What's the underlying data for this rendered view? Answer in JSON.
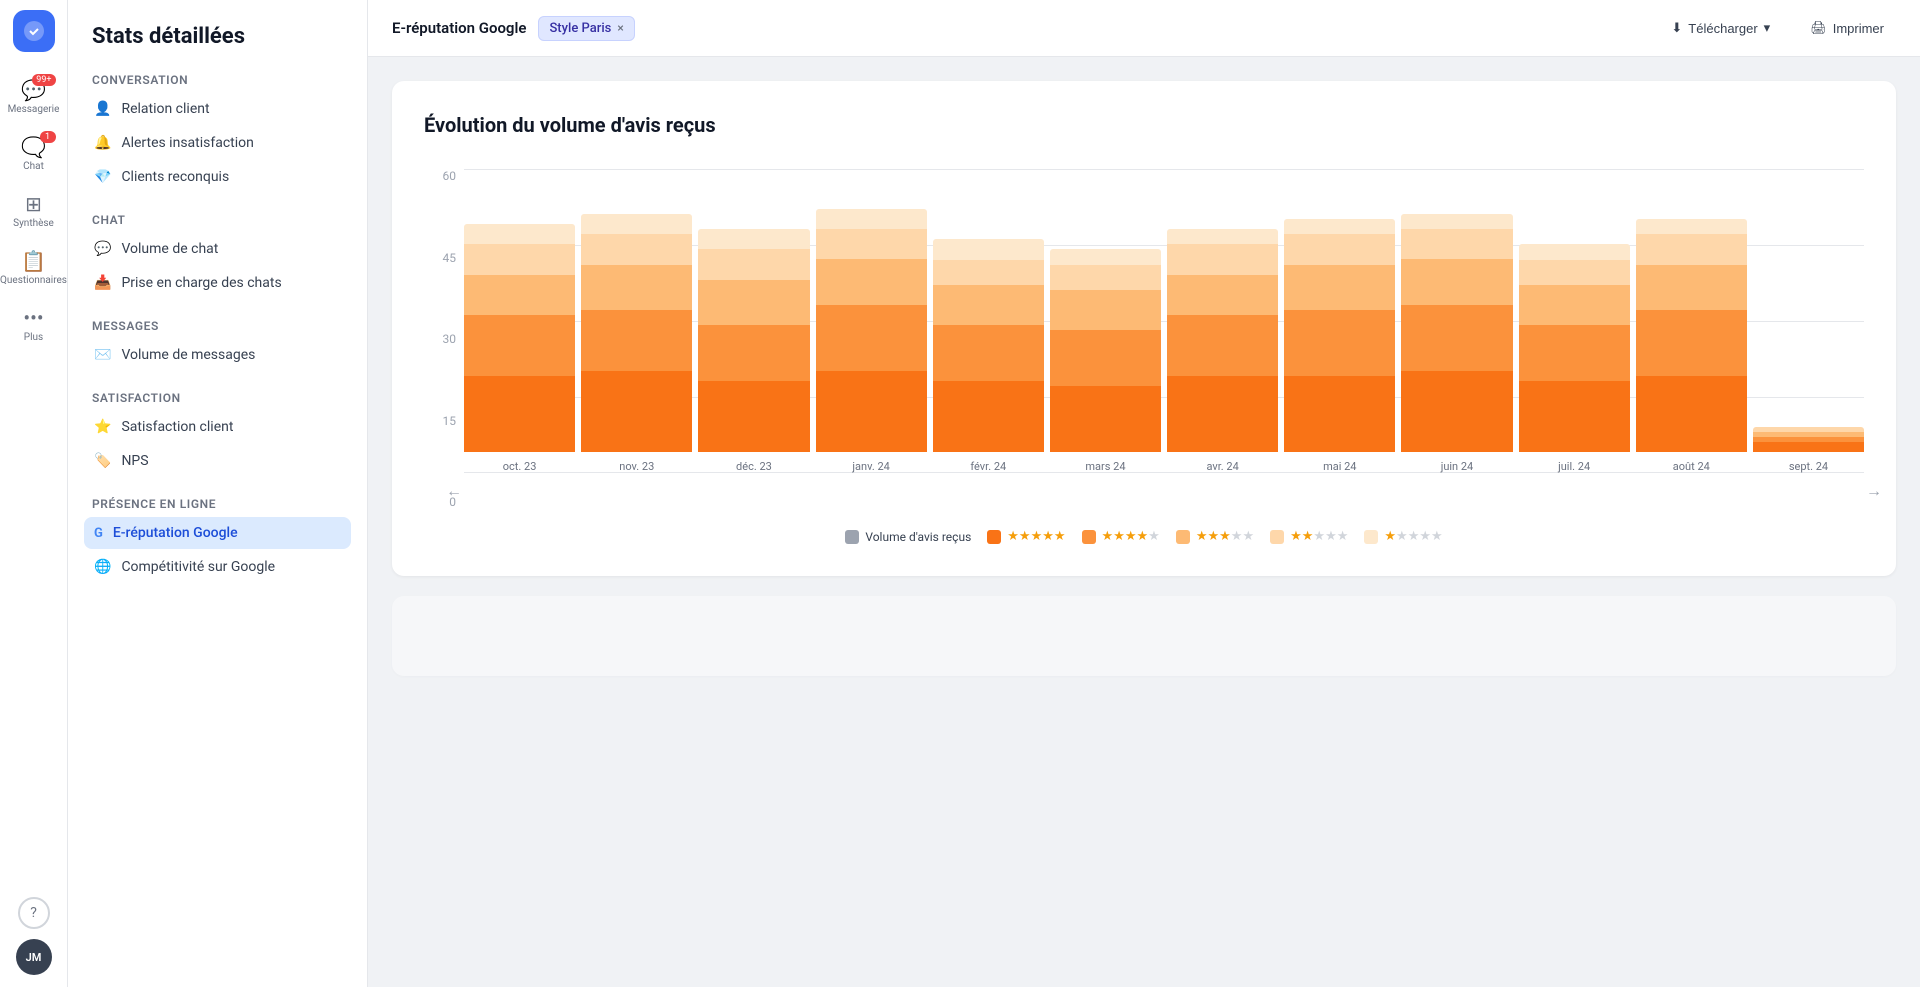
{
  "app": {
    "logo_alt": "App logo"
  },
  "iconBar": {
    "items": [
      {
        "id": "messagerie",
        "label": "Messagerie",
        "icon": "💬",
        "badge": "99+"
      },
      {
        "id": "chat",
        "label": "Chat",
        "icon": "🗨️",
        "badge": "1"
      },
      {
        "id": "synthese",
        "label": "Synthèse",
        "icon": "⊞",
        "badge": null
      },
      {
        "id": "questionnaires",
        "label": "Questionnaires",
        "icon": "📋",
        "badge": null
      },
      {
        "id": "plus",
        "label": "Plus",
        "icon": "⋯",
        "badge": null
      }
    ],
    "help_label": "?",
    "avatar_label": "JM"
  },
  "sidebar": {
    "title": "Stats détaillées",
    "sections": [
      {
        "id": "conversation",
        "label": "Conversation",
        "items": [
          {
            "id": "relation-client",
            "label": "Relation client",
            "icon": "👤"
          },
          {
            "id": "alertes-insatisfaction",
            "label": "Alertes insatisfaction",
            "icon": "🔔"
          },
          {
            "id": "clients-reconquis",
            "label": "Clients reconquis",
            "icon": "💎"
          }
        ]
      },
      {
        "id": "chat",
        "label": "Chat",
        "items": [
          {
            "id": "volume-chat",
            "label": "Volume de chat",
            "icon": "💬"
          },
          {
            "id": "prise-en-charge",
            "label": "Prise en charge des chats",
            "icon": "📥"
          }
        ]
      },
      {
        "id": "messages",
        "label": "Messages",
        "items": [
          {
            "id": "volume-messages",
            "label": "Volume de messages",
            "icon": "✉️"
          }
        ]
      },
      {
        "id": "satisfaction",
        "label": "Satisfaction",
        "items": [
          {
            "id": "satisfaction-client",
            "label": "Satisfaction client",
            "icon": "⭐"
          },
          {
            "id": "nps",
            "label": "NPS",
            "icon": "🏷️"
          }
        ]
      },
      {
        "id": "presence-en-ligne",
        "label": "Présence en ligne",
        "items": [
          {
            "id": "e-reputation-google",
            "label": "E-réputation Google",
            "icon": "G",
            "active": true
          },
          {
            "id": "competitivite-google",
            "label": "Compétitivité sur Google",
            "icon": "🌐"
          }
        ]
      }
    ]
  },
  "topBar": {
    "title": "E-réputation Google",
    "filter": {
      "label": "Style Paris",
      "close": "×"
    },
    "actions": [
      {
        "id": "telecharger",
        "label": "Télécharger",
        "icon": "⬇"
      },
      {
        "id": "imprimer",
        "label": "Imprimer",
        "icon": "🖨"
      }
    ]
  },
  "chart": {
    "title": "Évolution du volume d'avis reçus",
    "yLabels": [
      "60",
      "45",
      "30",
      "15",
      "0"
    ],
    "maxValue": 60,
    "bars": [
      {
        "month": "oct. 23",
        "total": 45,
        "segments": [
          15,
          12,
          8,
          6,
          4
        ]
      },
      {
        "month": "nov. 23",
        "total": 47,
        "segments": [
          16,
          12,
          9,
          6,
          4
        ]
      },
      {
        "month": "déc. 23",
        "total": 44,
        "segments": [
          14,
          11,
          9,
          6,
          4
        ]
      },
      {
        "month": "janv. 24",
        "total": 48,
        "segments": [
          16,
          13,
          9,
          6,
          4
        ]
      },
      {
        "month": "févr. 24",
        "total": 42,
        "segments": [
          14,
          11,
          8,
          5,
          4
        ]
      },
      {
        "month": "mars 24",
        "total": 40,
        "segments": [
          13,
          11,
          8,
          5,
          3
        ]
      },
      {
        "month": "avr. 24",
        "total": 44,
        "segments": [
          15,
          12,
          8,
          6,
          3
        ]
      },
      {
        "month": "mai 24",
        "total": 46,
        "segments": [
          15,
          13,
          9,
          6,
          3
        ]
      },
      {
        "month": "juin 24",
        "total": 47,
        "segments": [
          16,
          13,
          9,
          6,
          3
        ]
      },
      {
        "month": "juil. 24",
        "total": 41,
        "segments": [
          14,
          11,
          8,
          5,
          3
        ]
      },
      {
        "month": "août 24",
        "total": 46,
        "segments": [
          15,
          13,
          9,
          6,
          3
        ]
      },
      {
        "month": "sept. 24",
        "total": 5,
        "segments": [
          2,
          1,
          1,
          1,
          0
        ]
      }
    ],
    "segmentColors": [
      "#f97316",
      "#fb923c",
      "#fdba74",
      "#fed7aa",
      "#fde8cc"
    ],
    "nav": {
      "prev": "←",
      "next": "→"
    },
    "legend": {
      "volumeLabel": "Volume d'avis reçus",
      "volumeColor": "#9ca3af",
      "ratings": [
        {
          "id": "5stars",
          "stars": 5,
          "color": "#f97316",
          "checked": true
        },
        {
          "id": "4stars",
          "stars": 4,
          "color": "#fb923c",
          "checked": true
        },
        {
          "id": "3stars",
          "stars": 3,
          "color": "#fdba74",
          "checked": true
        },
        {
          "id": "2stars",
          "stars": 2,
          "color": "#fed7aa",
          "checked": true
        },
        {
          "id": "1star",
          "stars": 1,
          "color": "#fde8cc",
          "checked": true
        }
      ]
    }
  }
}
